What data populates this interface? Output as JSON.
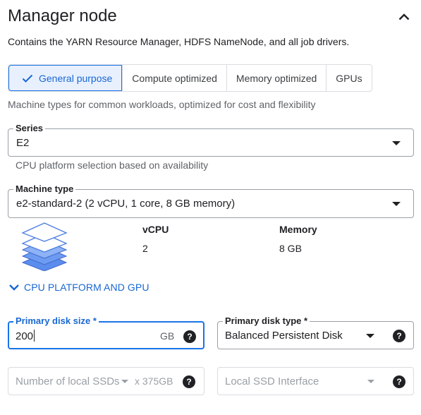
{
  "header": {
    "title": "Manager node"
  },
  "description": "Contains the YARN Resource Manager, HDFS NameNode, and all job drivers.",
  "machine_family": {
    "tabs": [
      {
        "label": "General purpose",
        "selected": true
      },
      {
        "label": "Compute optimized",
        "selected": false
      },
      {
        "label": "Memory optimized",
        "selected": false
      },
      {
        "label": "GPUs",
        "selected": false
      }
    ],
    "hint": "Machine types for common workloads, optimized for cost and flexibility"
  },
  "series": {
    "label": "Series",
    "value": "E2",
    "hint": "CPU platform selection based on availability"
  },
  "machine_type": {
    "label": "Machine type",
    "value": "e2-standard-2 (2 vCPU, 1 core, 8 GB memory)"
  },
  "specs": {
    "vcpu_header": "vCPU",
    "vcpu_value": "2",
    "memory_header": "Memory",
    "memory_value": "8 GB"
  },
  "expander": {
    "label": "CPU PLATFORM AND GPU"
  },
  "primary_disk_size": {
    "label": "Primary disk size *",
    "value": "200",
    "unit": "GB"
  },
  "primary_disk_type": {
    "label": "Primary disk type *",
    "value": "Balanced Persistent Disk"
  },
  "local_ssds": {
    "placeholder": "Number of local SSDs",
    "unit": "x 375GB"
  },
  "local_ssd_interface": {
    "placeholder": "Local SSD Interface"
  },
  "colors": {
    "accent": "#1a73e8",
    "accent_text": "#1967d2",
    "selected_bg": "#e8f0fe",
    "border": "#9aa0a6"
  },
  "icons": [
    "chevron-up-icon",
    "check-icon",
    "dropdown-arrow-icon",
    "stacked-layers-icon",
    "chevron-down-icon",
    "help-icon"
  ]
}
